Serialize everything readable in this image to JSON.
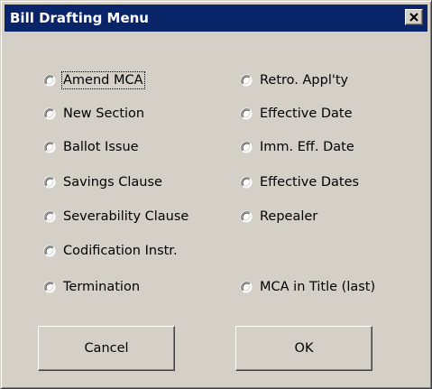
{
  "window": {
    "title": "Bill Drafting Menu",
    "close_icon": "close-x-icon"
  },
  "options": {
    "left": [
      {
        "label": "Amend MCA",
        "selected": false,
        "focused": true
      },
      {
        "label": "New Section",
        "selected": false
      },
      {
        "label": "Ballot Issue",
        "selected": false
      },
      {
        "label": "Savings Clause",
        "selected": false
      },
      {
        "label": "Severability Clause",
        "selected": false
      },
      {
        "label": "Codification Instr.",
        "selected": false
      },
      {
        "label": "Termination",
        "selected": false
      }
    ],
    "right": [
      {
        "label": "Retro. Appl'ty",
        "selected": false
      },
      {
        "label": "Effective Date",
        "selected": false
      },
      {
        "label": "Imm. Eff. Date",
        "selected": false
      },
      {
        "label": "Effective Dates",
        "selected": false
      },
      {
        "label": "Repealer",
        "selected": false
      },
      {
        "label": "MCA in Title (last)",
        "selected": false
      }
    ]
  },
  "buttons": {
    "cancel_label": "Cancel",
    "ok_label": "OK"
  },
  "colors": {
    "dialog_face": "#d4d0c8",
    "titlebar": "#0a246a",
    "title_text": "#ffffff"
  }
}
